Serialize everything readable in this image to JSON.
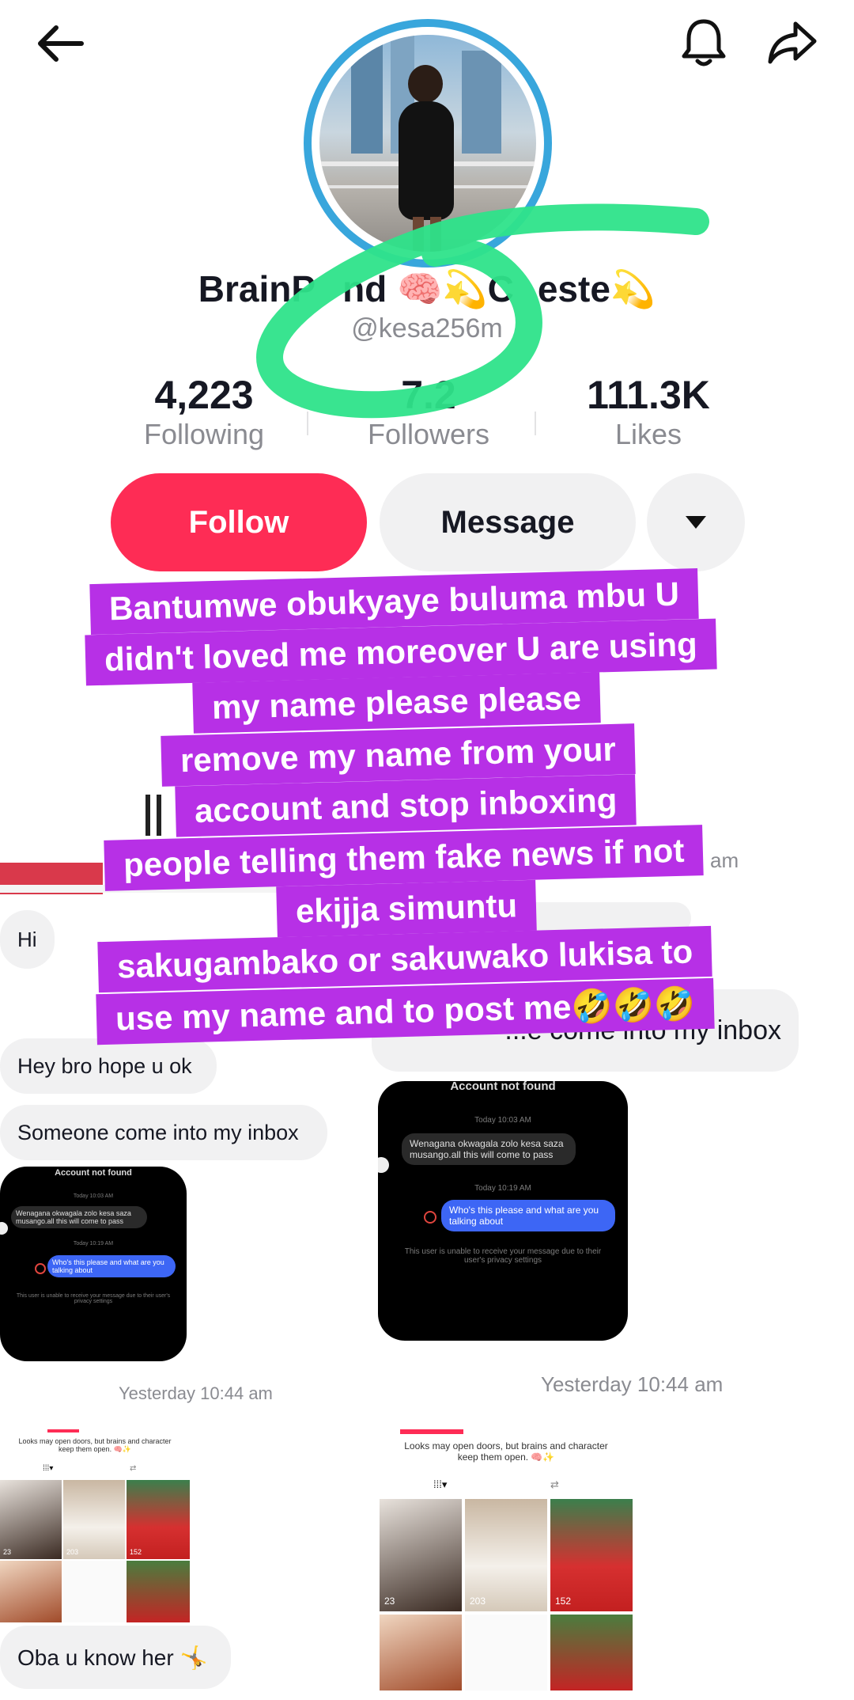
{
  "topbar": {
    "back_icon": "back-arrow-icon",
    "bell_icon": "bell-icon",
    "share_icon": "share-icon"
  },
  "profile": {
    "name_left": "BrainP",
    "name_mid": "nd",
    "name_right": "C",
    "name_end": "este",
    "handle": "@kesa256m",
    "stats": [
      {
        "value": "4,223",
        "label": "Following"
      },
      {
        "value": "7.2",
        "label": "Followers"
      },
      {
        "value": "111.3K",
        "label": "Likes"
      }
    ],
    "follow_label": "Follow",
    "message_label": "Message",
    "more_icon": "caret-down-icon"
  },
  "caption": {
    "lines": [
      "Bantumwe obukyaye buluma mbu U",
      "didn't loved me moreover U are using",
      "my name please please",
      "remove my name from your",
      "account and stop inboxing",
      "people telling them fake news if not",
      "ekijja simuntu",
      "sakugambako or sakuwako lukisa to",
      "use my name and to post me🤣🤣🤣"
    ]
  },
  "left_chat": {
    "hi": "Hi",
    "msg1": "Hey bro hope u ok",
    "msg2": "Someone come into my inbox",
    "timestamp": "Yesterday 10:44 am",
    "last": "Oba u know her 🤸"
  },
  "right_chat": {
    "partial_ts": "am",
    "msg_partial": "...e come into my inbox",
    "timestamp": "Yesterday 10:44 am"
  },
  "screenshot_dm": {
    "title": "Account not found",
    "time1": "Today 10:03 AM",
    "received": "Wenagana okwagala zolo kesa saza musango.all this will come to pass",
    "time2": "Today 10:19 AM",
    "sent": "Who's this please and what are you talking about",
    "notice": "This user is unable to receive your message due to their user's privacy settings"
  },
  "profile_card": {
    "bio": "Looks may open doors, but brains and character keep them open. 🧠✨",
    "views": [
      "23",
      "203",
      "152"
    ]
  }
}
